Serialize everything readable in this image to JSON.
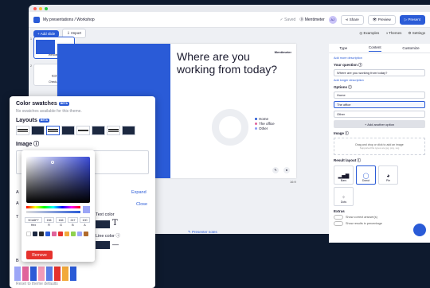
{
  "topbar": {
    "breadcrumb": "My presentations / Workshop",
    "saved": "Saved",
    "brand": "Mentimeter",
    "avatar": "AJ",
    "share": "Share",
    "preview": "Preview",
    "present": "Present"
  },
  "toolbar": {
    "add_slide": "+ Add slide",
    "import": "Import",
    "examples": "Examples",
    "themes": "Themes",
    "settings": "Settings"
  },
  "thumbnails": [
    {
      "num": "1",
      "label": "Welcome"
    },
    {
      "num": "2",
      "label": "Check-in"
    },
    {
      "num": "3",
      "label": ""
    }
  ],
  "slide": {
    "question": "Where are you working from today?",
    "brand": "Mentimeter",
    "legend": [
      "Home",
      "The office",
      "Other"
    ],
    "footer_link": "Presenter notes",
    "ratio_text": "16:9"
  },
  "colors": {
    "accent": "#2a5bd7",
    "legend": [
      "#2a5bd7",
      "#e0649b",
      "#8a9cf7"
    ]
  },
  "right_panel": {
    "tabs": [
      "Type",
      "Content",
      "Customize"
    ],
    "add_desc": "Add more description",
    "your_question": "Your question",
    "question_value": "Where are you working from today?",
    "add_longer": "Add longer description",
    "options_label": "Options",
    "options": [
      "Home",
      "The office",
      "Other"
    ],
    "add_option": "+ Add another option",
    "image_label": "Image",
    "drop_text": "Drag and drop or click to add an image",
    "drop_sub": "Supported file types are jpg, png, svg",
    "result_layout": "Result layout",
    "layouts": [
      "Bars",
      "Donut",
      "Pie",
      "Dots"
    ],
    "extras": "Extras",
    "extra1": "Show correct answer(s)",
    "extra2": "Show results in percentage"
  },
  "swatches": {
    "title": "Color swatches",
    "beta": "BETA",
    "none_text": "No swatches available for this theme.",
    "layouts_label": "Layouts",
    "image_label": "Image",
    "expand": "Expand",
    "close": "Close",
    "text_color": "Text color",
    "line_color": "Line color",
    "reset": "Reset to theme defaults",
    "partial_a1": "A",
    "partial_a2": "A",
    "partial_t": "T",
    "partial_b": "B",
    "plus": "+"
  },
  "picker": {
    "hex": "9CA6F7",
    "r": "156",
    "g": "166",
    "b": "247",
    "a": "100",
    "labels": [
      "Hex",
      "R",
      "G",
      "B",
      "A"
    ],
    "remove": "Remove",
    "chips": [
      "#ffffff",
      "#1c2840",
      "#2a2a2a",
      "#2a5bd7",
      "#e0649b",
      "#e5322d",
      "#f2a93b",
      "#8fd14f",
      "#9ca6f7",
      "#b06a2c"
    ]
  }
}
